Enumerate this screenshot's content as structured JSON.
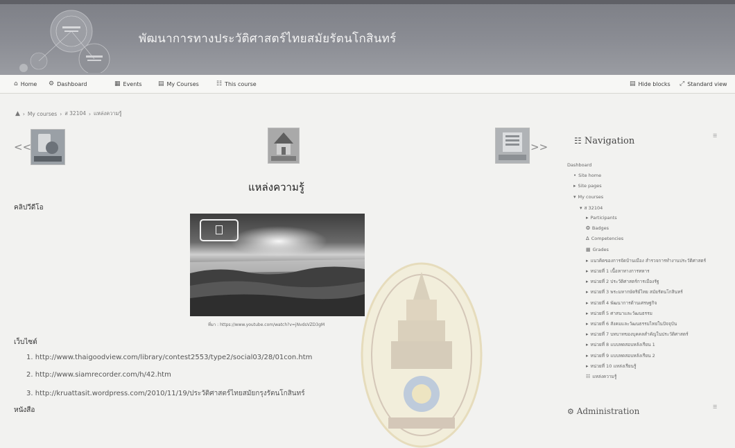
{
  "header": {
    "title": "พัฒนาการทางประวัติศาสตร์ไทยสมัยรัตนโกสินทร์"
  },
  "navbar": {
    "home": "Home",
    "dashboard": "Dashboard",
    "events": "Events",
    "my_courses": "My Courses",
    "this_course": "This course",
    "hide_blocks": "Hide blocks",
    "standard_view": "Standard view"
  },
  "breadcrumb": {
    "my_courses": "My courses",
    "course": "ส 32104",
    "current": "แหล่งความรู้"
  },
  "activity_nav": {
    "prev": "<<",
    "next": ">>"
  },
  "main": {
    "heading": "แหล่งความรู้",
    "video_section": "คลิปวีดีโอ",
    "video_caption": "ที่มา : https://www.youtube.com/watch?v=jNvdsVZD3gM",
    "website_section": "เว็บไซต์",
    "links": [
      {
        "num": "1.",
        "url": "http://www.thaigoodview.com/library/contest2553/type2/social03/28/01con.htm"
      },
      {
        "num": "2.",
        "url": "http://www.siamrecorder.com/h/42.htm"
      },
      {
        "num": "3.",
        "url": "http://kruattasit.wordpress.com/2010/11/19/ประวัติศาสตร์ไทยสมัยกรุงรัตนโกสินทร์"
      }
    ],
    "book_section": "หนังสือ"
  },
  "navigation_block": {
    "title": "Navigation",
    "items": [
      {
        "label": "Dashboard",
        "level": 0,
        "icon": ""
      },
      {
        "label": "Site home",
        "level": 1,
        "icon": "bullet"
      },
      {
        "label": "Site pages",
        "level": 1,
        "icon": "arrow"
      },
      {
        "label": "My courses",
        "level": 1,
        "icon": "arrow-down"
      },
      {
        "label": "ส 32104",
        "level": 2,
        "icon": "arrow-down"
      },
      {
        "label": "Participants",
        "level": 3,
        "icon": "arrow"
      },
      {
        "label": "Badges",
        "level": 3,
        "icon": "badge"
      },
      {
        "label": "Competencies",
        "level": 3,
        "icon": "competency"
      },
      {
        "label": "Grades",
        "level": 3,
        "icon": "grades"
      },
      {
        "label": "แนวคิดของการจัดบ้านเมือง สำรวจการทำงานประวัติศาสตร์",
        "level": 3,
        "icon": "arrow"
      },
      {
        "label": "หน่วยที่ 1 เนื้อหาทางการทหาร",
        "level": 3,
        "icon": "arrow"
      },
      {
        "label": "หน่วยที่ 2 ประวัติศาสตร์การเมืองรัฐ",
        "level": 3,
        "icon": "arrow"
      },
      {
        "label": "หน่วยที่ 3 พระมหากษัตริย์ไทย สมัยรัตนโกสินทร์",
        "level": 3,
        "icon": "arrow"
      },
      {
        "label": "หน่วยที่ 4 พัฒนาการด้านเศรษฐกิจ",
        "level": 3,
        "icon": "arrow"
      },
      {
        "label": "หน่วยที่ 5 ศาสนาและวัฒนธรรม",
        "level": 3,
        "icon": "arrow"
      },
      {
        "label": "หน่วยที่ 6 สังคมและวัฒนธรรมไทยในปัจจุบัน",
        "level": 3,
        "icon": "arrow"
      },
      {
        "label": "หน่วยที่ 7 บทบาทของบุคคลสำคัญในประวัติศาสตร์",
        "level": 3,
        "icon": "arrow"
      },
      {
        "label": "หน่วยที่ 8 แบบทดสอบหลังเรียน 1",
        "level": 3,
        "icon": "arrow"
      },
      {
        "label": "หน่วยที่ 9 แบบทดสอบหลังเรียน 2",
        "level": 3,
        "icon": "arrow"
      },
      {
        "label": "หน่วยที่ 10 แหล่งเรียนรู้",
        "level": 3,
        "icon": "arrow"
      },
      {
        "label": "แหล่งความรู้",
        "level": 3,
        "icon": "page"
      }
    ]
  },
  "admin_block": {
    "title": "Administration"
  },
  "colors": {
    "banner": "#8b8d94",
    "navbar_bg": "#f7f7f5",
    "page_bg": "#f2f2f0"
  }
}
